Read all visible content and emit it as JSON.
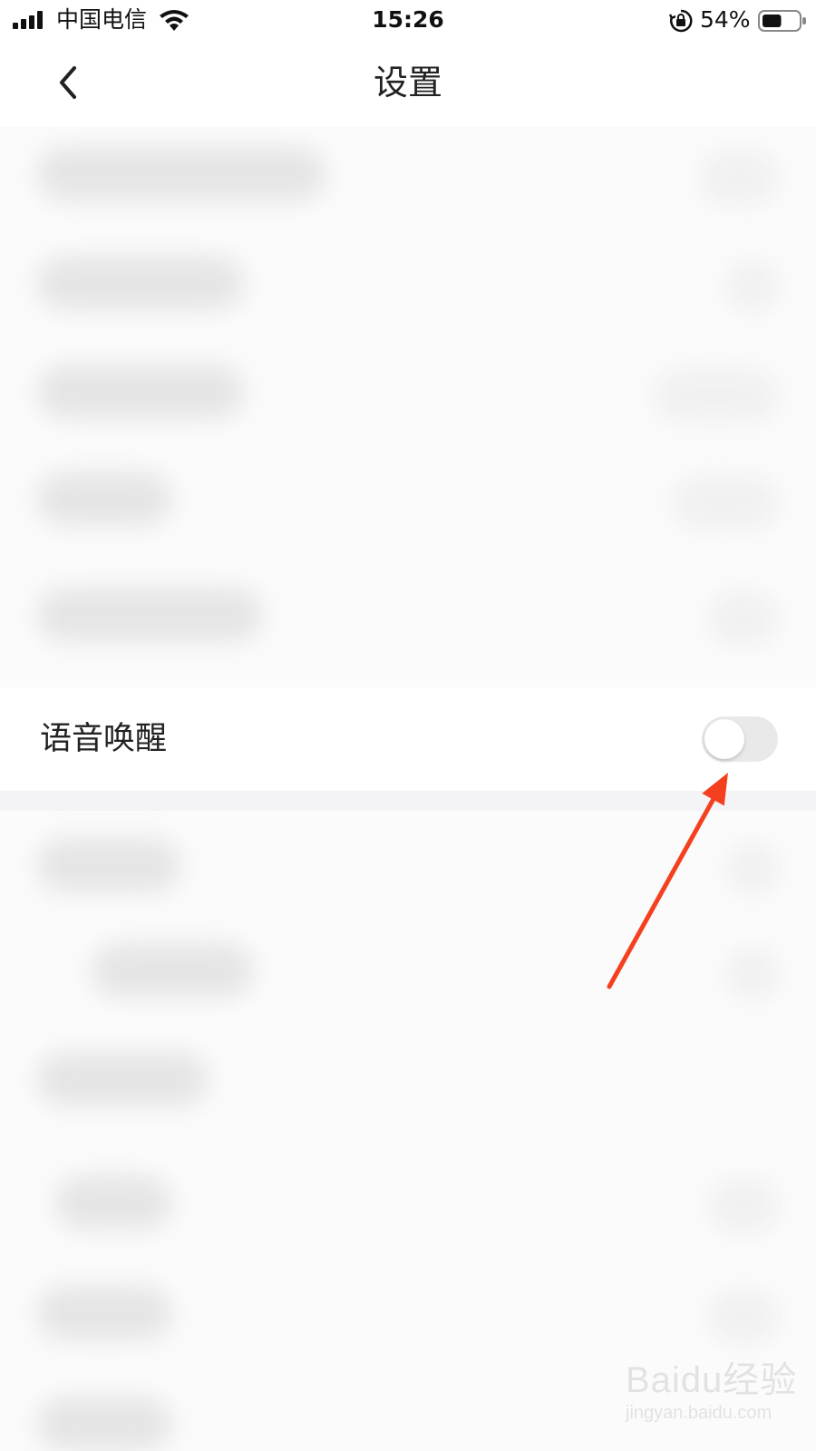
{
  "status_bar": {
    "carrier": "中国电信",
    "time": "15:26",
    "battery_percent": "54%",
    "battery_level": 0.54,
    "icons": [
      "signal-icon",
      "wifi-icon",
      "orientation-lock-icon",
      "battery-icon"
    ]
  },
  "nav": {
    "title": "设置",
    "back_icon": "chevron-left-icon"
  },
  "settings": {
    "voice_wake": {
      "label": "语音唤醒",
      "enabled": false
    }
  },
  "annotation": {
    "type": "arrow",
    "color": "#f5401f",
    "points_to": "voice-wake-toggle"
  },
  "watermark": {
    "brand": "Baidu经验",
    "url": "jingyan.baidu.com"
  },
  "colors": {
    "background": "#ffffff",
    "toggle_off": "#e9e9ea",
    "divider_band": "#f4f4f6",
    "arrow": "#f5401f"
  }
}
